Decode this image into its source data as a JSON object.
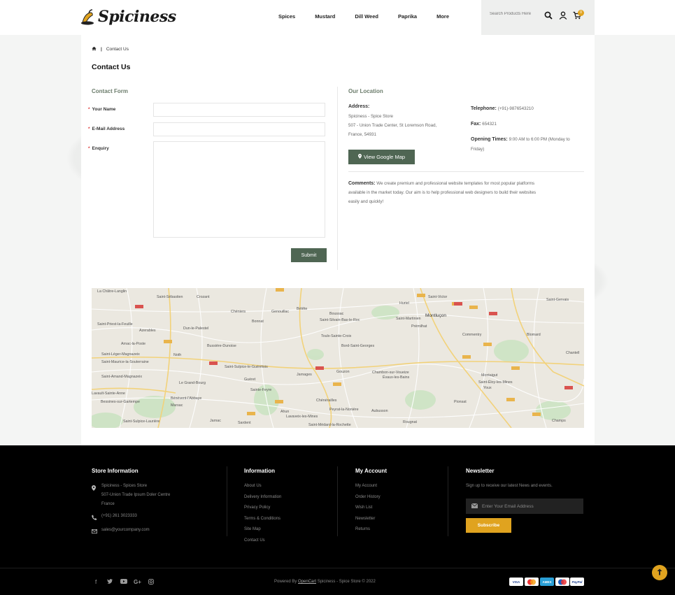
{
  "brand": {
    "name": "Spiciness"
  },
  "nav": [
    "Spices",
    "Mustard",
    "Dill Weed",
    "Paprika",
    "More"
  ],
  "search": {
    "placeholder": "Search Products Here"
  },
  "cart": {
    "count": "0"
  },
  "breadcrumb": {
    "current": "Contact Us"
  },
  "page": {
    "title": "Contact Us"
  },
  "form": {
    "title": "Contact Form",
    "name_label": "Your Name",
    "email_label": "E-Mail Address",
    "enquiry_label": "Enquiry",
    "required_mark": "*",
    "submit_label": "Submit"
  },
  "location": {
    "title": "Our Location",
    "address_label": "Address:",
    "address_line1": "Spiciness - Spice Store",
    "address_line2": "507 - Union Trade Center, St Loremson Road,",
    "address_line3": "France, 54931",
    "map_button": "View Google Map",
    "telephone_label": "Telephone:",
    "telephone": "(+91)-9876543210",
    "fax_label": "Fax:",
    "fax": "654321",
    "hours_label": "Opening Times:",
    "hours": "9:00 AM to 6:00 PM (Monday to",
    "hours2": "Friday)",
    "comments_label": "Comments:",
    "comments1": "We create premium and professional website templates for most popular platforms",
    "comments2": "available in the market today. Our aim is to help professional web designers to build their websites",
    "comments3": "easily and quickly!"
  },
  "map": {
    "cities": [
      "La Châtre-Langlin",
      "Saint-Sébastien",
      "Crozant",
      "Chéniers",
      "Genouillac",
      "Bétête",
      "Boussac",
      "Saint-Silvain-Bas-le-Roc",
      "Huriel",
      "Saint-Victor",
      "Montluçon",
      "Saint-Martinien",
      "Prémilhat",
      "Saint-Priest-la-Feuille",
      "Azerables",
      "Dun-le-Palestel",
      "Bonnat",
      "Toulx-Sainte-Croix",
      "Bord-Saint-Georges",
      "Commentry",
      "Blomard",
      "Arnac-la-Poste",
      "Bussière-Dunoise",
      "Saint-Léger-Magnazeix",
      "Noth",
      "Saint-Sulpice-le-Guérétois",
      "Gouzon",
      "Saint-Maurice-la-Souterraine",
      "Jarnages",
      "Chambon-sur-Voueize",
      "Évaux-les-Bains",
      "Montaigut",
      "Saint-Éloy-les-Mines",
      "Saint-Amand-Magnazeix",
      "Guéret",
      "Le Grand-Bourg",
      "Sainte-Feyre",
      "Youx",
      "Bénévent-l'Abbaye",
      "Marsac",
      "Chénérailles",
      "Peyrat-la-Nonière",
      "Pionsat",
      "Bessines-sur-Gartempe",
      "Ahun",
      "Aubusson",
      "Saint-Sulpice-Laurière",
      "Sardent",
      "Jarnac",
      "Lavaveix-les-Mines",
      "Saint-Médard-la-Rochette",
      "Rougnat",
      "Champs",
      "Chantell",
      "Lavault-Sainte-Anne",
      "Saint-Gervais"
    ]
  },
  "footer": {
    "store_title": "Store Information",
    "store_line1": "Spiciness - Spices Store",
    "store_line2": "507-Union Trade Ipsum Doler Centre",
    "store_line3": "France",
    "store_phone": "(+91) 261 3023333",
    "store_email": "sales@yourcompany.com",
    "info_title": "Information",
    "info_links": [
      "About Us",
      "Delivery Information",
      "Privacy Policy",
      "Terms & Conditions",
      "Site Map",
      "Contact Us"
    ],
    "account_title": "My Account",
    "account_links": [
      "My Account",
      "Order History",
      "Wish List",
      "Newsletter",
      "Returns"
    ],
    "news_title": "Newsletter",
    "news_text": "Sign up to receive our latest News and events.",
    "news_placeholder": "Enter Your Email Address",
    "subscribe_label": "Subscribe",
    "powered_prefix": "Powered By",
    "powered_link": "OpenCart",
    "powered_suffix": "Spiciness - Spice Store © 2022",
    "payments": [
      "VISA",
      "MC",
      "AMEX",
      "MAESTRO",
      "PayPal"
    ]
  },
  "colors": {
    "accent": "#e0a31f",
    "primary": "#4f6653",
    "footer_bg": "#000000"
  }
}
